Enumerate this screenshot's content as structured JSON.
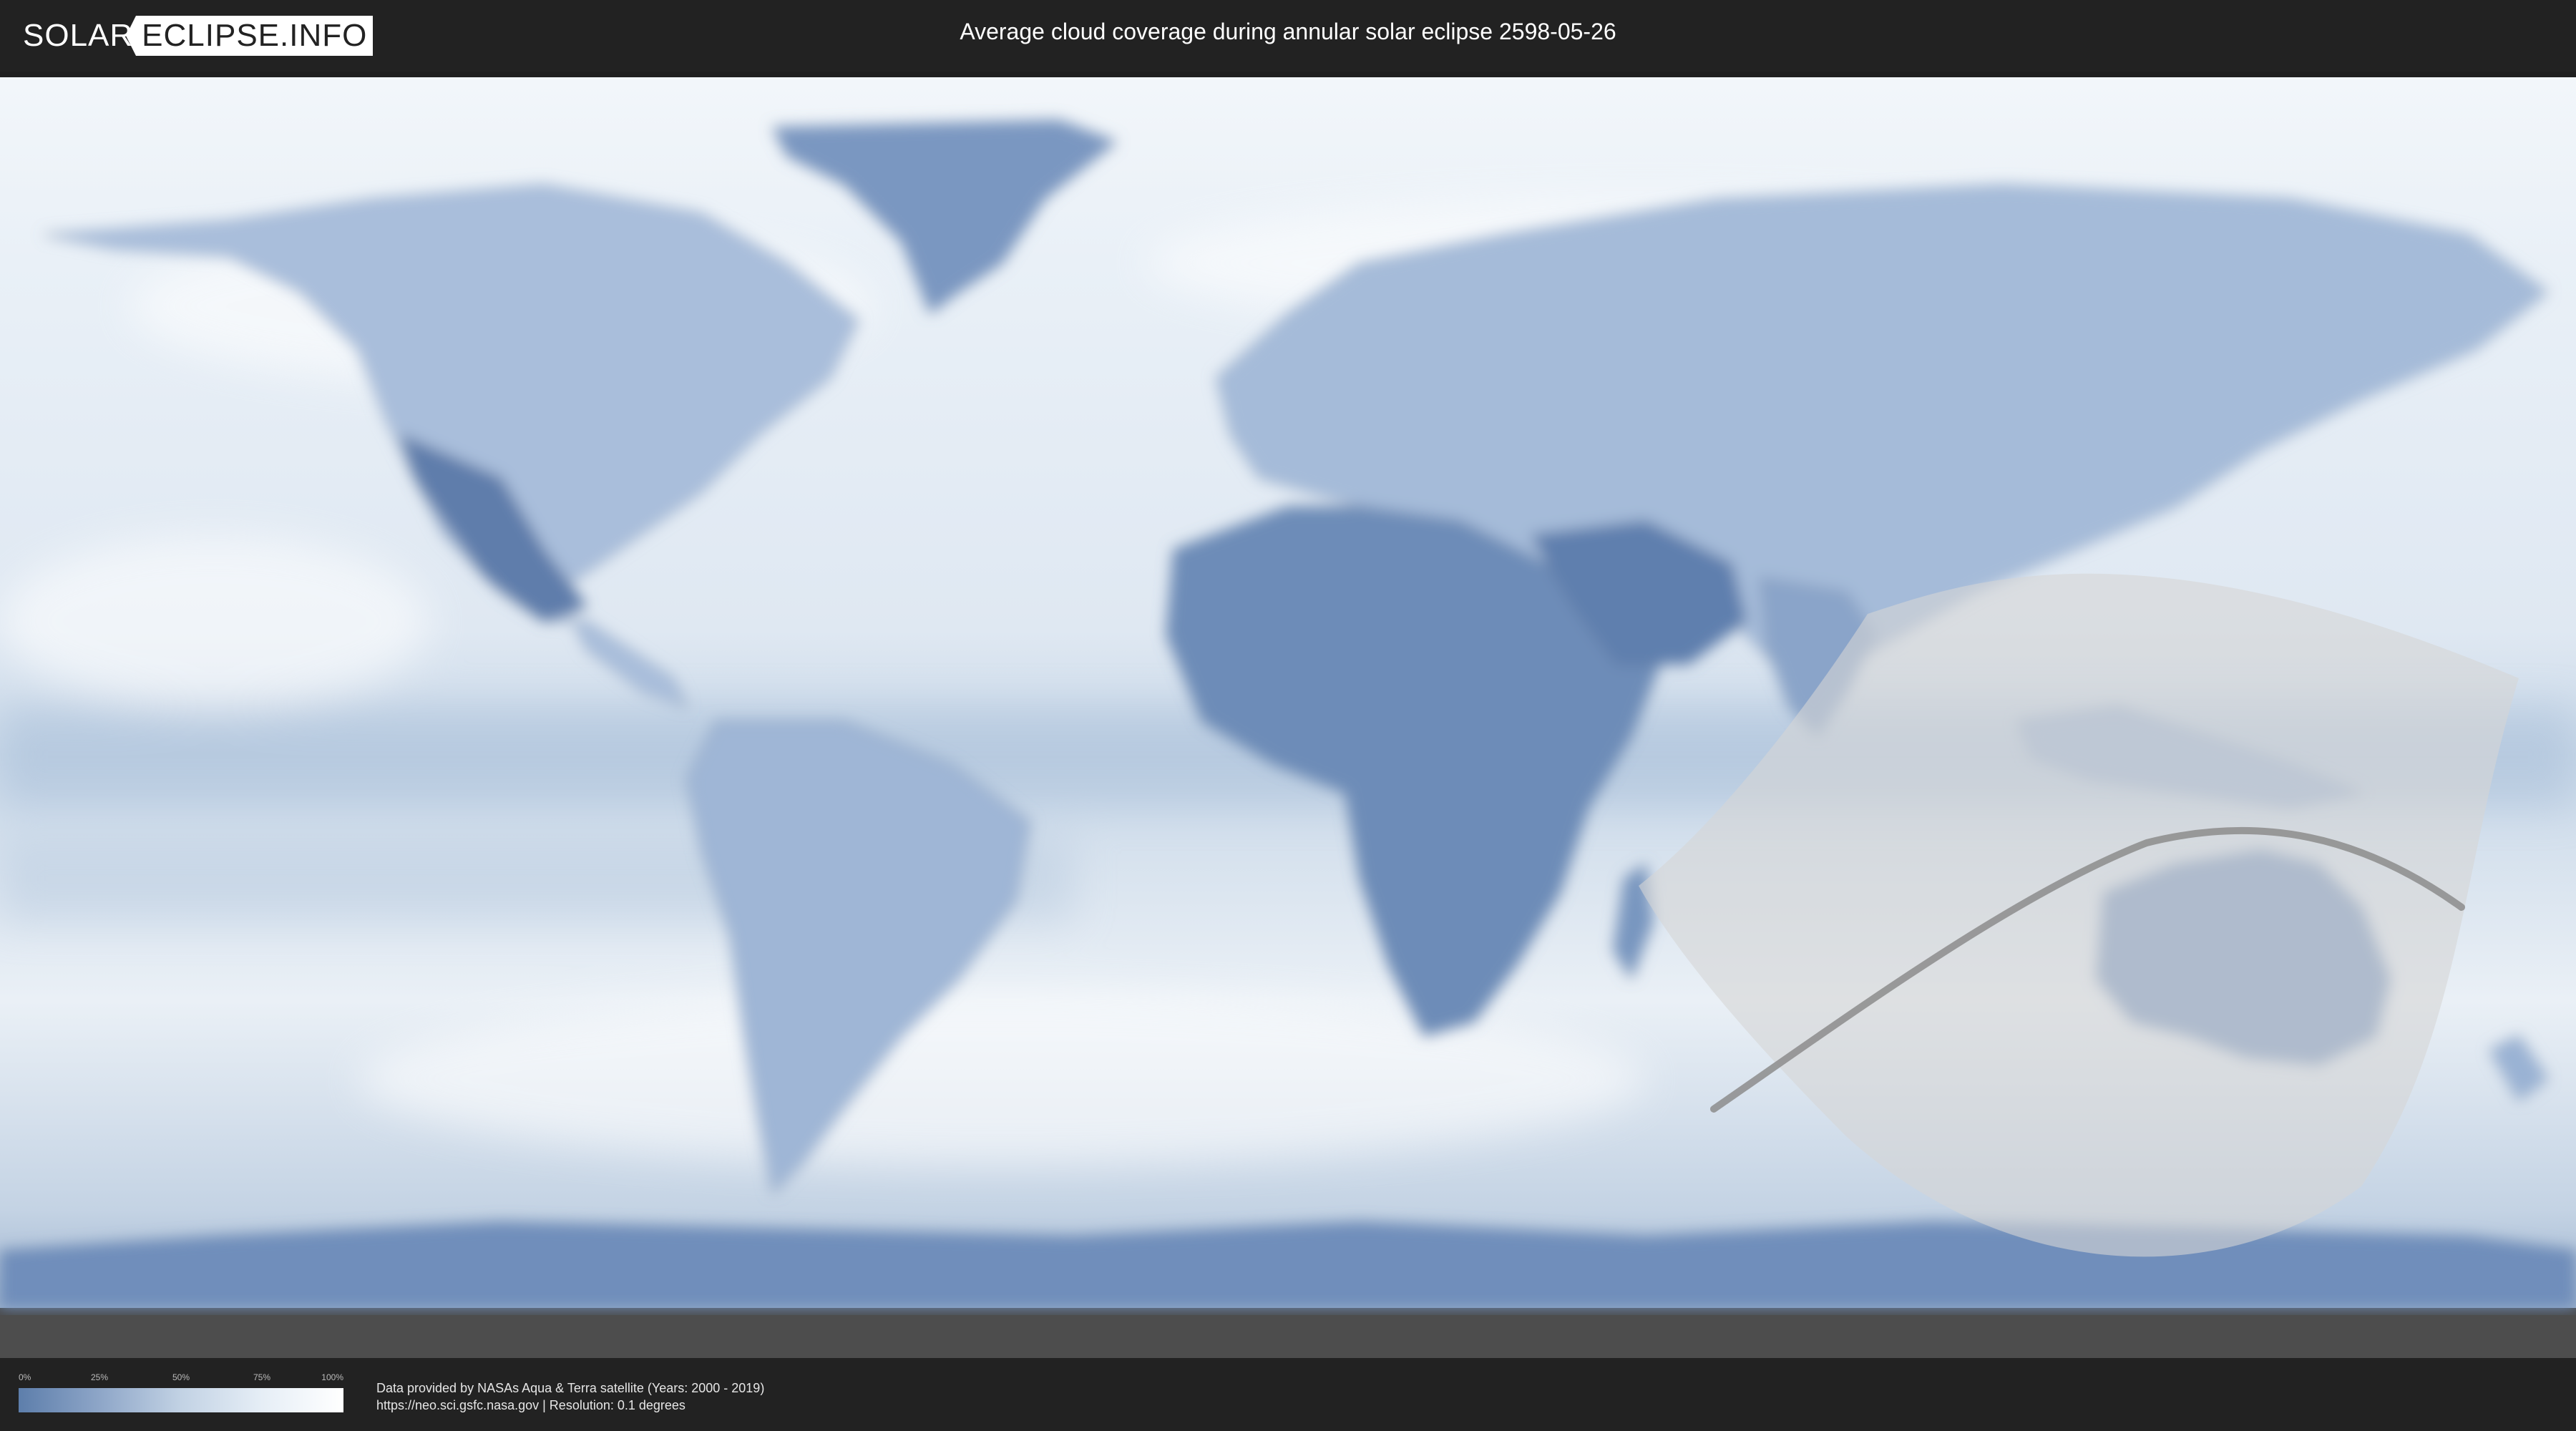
{
  "header": {
    "logo_left": "SOLAR",
    "logo_right": "ECLIPSE.INFO",
    "title": "Average cloud coverage during annular solar eclipse 2598-05-26"
  },
  "legend": {
    "ticks": [
      "0%",
      "25%",
      "50%",
      "75%",
      "100%"
    ],
    "colors": [
      "#5d7eab",
      "#8ea6c8",
      "#c2d2e4",
      "#e6eef6",
      "#ffffff"
    ]
  },
  "footer": {
    "credit_line1": "Data provided by NASAs Aqua & Terra satellite (Years: 2000 - 2019)",
    "credit_line2": "https://neo.sci.gsfc.nasa.gov | Resolution: 0.1 degrees"
  },
  "map": {
    "ocean_color": "#e4ecf4",
    "land_color": "#6d8cb8",
    "eclipse_zone_color": "#d6d6d6",
    "central_path_color": "#8c8c8c"
  }
}
